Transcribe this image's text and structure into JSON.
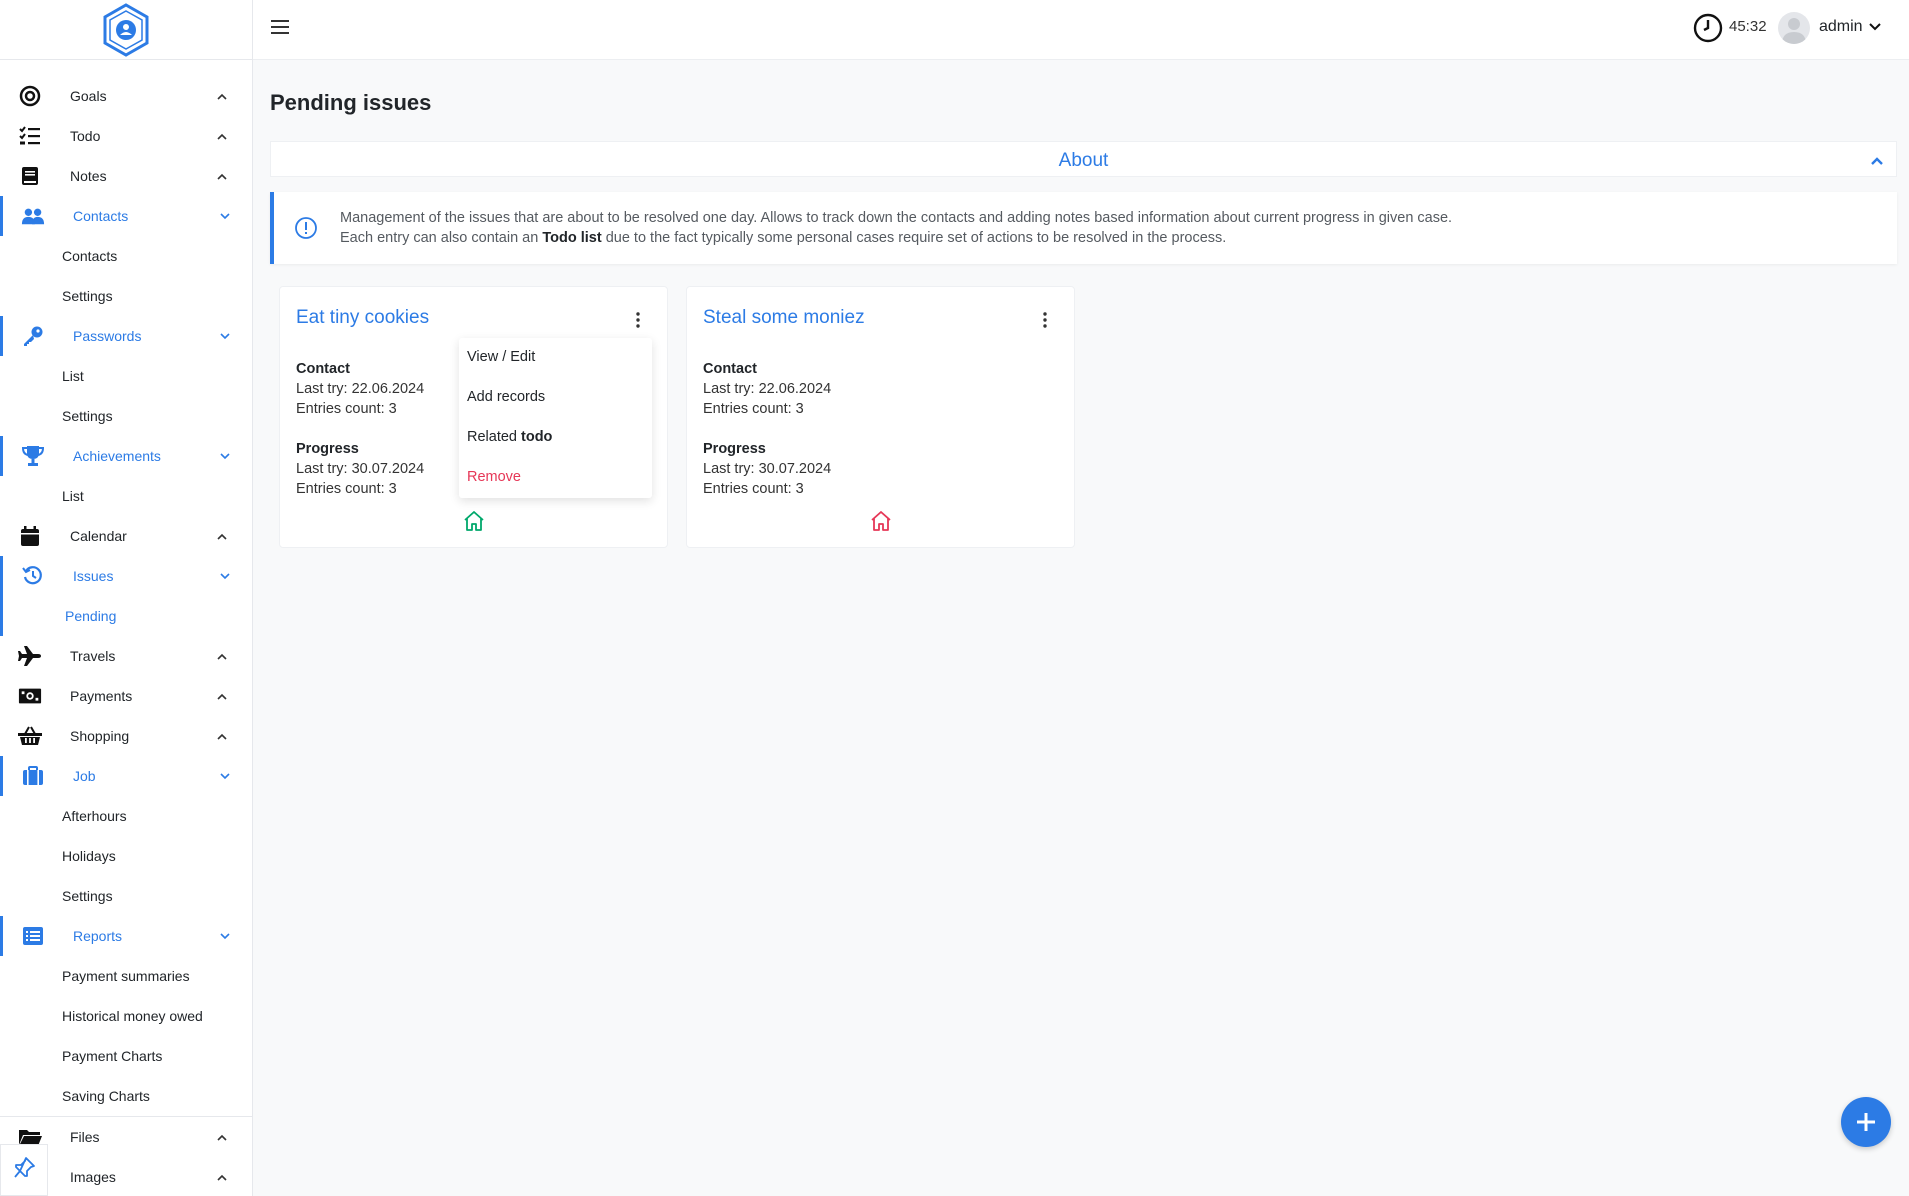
{
  "sidebar": {
    "items": [
      {
        "label": "Goals",
        "icon": "target-icon",
        "expanded": false
      },
      {
        "label": "Todo",
        "icon": "checklist-icon",
        "expanded": false
      },
      {
        "label": "Notes",
        "icon": "book-icon",
        "expanded": false
      },
      {
        "label": "Contacts",
        "icon": "users-icon",
        "expanded": true,
        "children": [
          "Contacts",
          "Settings"
        ]
      },
      {
        "label": "Passwords",
        "icon": "key-icon",
        "expanded": true,
        "children": [
          "List",
          "Settings"
        ]
      },
      {
        "label": "Achievements",
        "icon": "trophy-icon",
        "expanded": true,
        "children": [
          "List"
        ]
      },
      {
        "label": "Calendar",
        "icon": "calendar-icon",
        "expanded": false
      },
      {
        "label": "Issues",
        "icon": "history-icon",
        "expanded": true,
        "children": [
          "Pending"
        ]
      },
      {
        "label": "Travels",
        "icon": "plane-icon",
        "expanded": false
      },
      {
        "label": "Payments",
        "icon": "money-icon",
        "expanded": false
      },
      {
        "label": "Shopping",
        "icon": "basket-icon",
        "expanded": false
      },
      {
        "label": "Job",
        "icon": "briefcase-icon",
        "expanded": true,
        "children": [
          "Afterhours",
          "Holidays",
          "Settings"
        ]
      },
      {
        "label": "Reports",
        "icon": "list-icon",
        "expanded": true,
        "children": [
          "Payment summaries",
          "Historical money owed",
          "Payment Charts",
          "Saving Charts"
        ]
      },
      {
        "label": "Files",
        "icon": "folder-icon",
        "expanded": false
      },
      {
        "label": "Images",
        "icon": "image-icon",
        "expanded": false
      }
    ],
    "current": "Pending"
  },
  "topbar": {
    "timer": "45:32",
    "username": "admin"
  },
  "page": {
    "title": "Pending issues",
    "about_title": "About",
    "info_line1": "Management of the issues that are about to be resolved one day. Allows to track down the contacts and adding notes based information about current progress in given case.",
    "info_line2_pre": "Each entry can also contain an ",
    "info_line2_bold": "Todo list",
    "info_line2_post": " due to the fact typically some personal cases require set of actions to be resolved in the process."
  },
  "cards": [
    {
      "title": "Eat tiny cookies",
      "contact_heading": "Contact",
      "contact_last_try": "Last try: 22.06.2024",
      "contact_entries": "Entries count: 3",
      "progress_heading": "Progress",
      "progress_last_try": "Last try: 30.07.2024",
      "progress_entries": "Entries count: 3",
      "home_color": "#00a86b"
    },
    {
      "title": "Steal some moniez",
      "contact_heading": "Contact",
      "contact_last_try": "Last try: 22.06.2024",
      "contact_entries": "Entries count: 3",
      "progress_heading": "Progress",
      "progress_last_try": "Last try: 30.07.2024",
      "progress_entries": "Entries count: 3",
      "home_color": "#e63757"
    }
  ],
  "dropdown": {
    "view_edit": "View / Edit",
    "add_records": "Add records",
    "related_pre": "Related ",
    "related_bold": "todo",
    "remove": "Remove"
  },
  "colors": {
    "accent": "#2c7be5",
    "danger": "#e63757",
    "success": "#00a86b"
  }
}
